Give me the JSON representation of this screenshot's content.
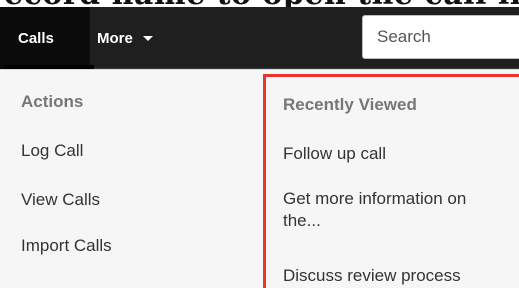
{
  "caption": {
    "partial_text": "ecord name to open the call in de"
  },
  "navbar": {
    "tabs": [
      {
        "label": "Calls",
        "active": true
      },
      {
        "label": "More",
        "has_caret": true
      }
    ],
    "search": {
      "placeholder": "Search"
    }
  },
  "dropdown": {
    "actions": {
      "header": "Actions",
      "items": [
        "Log Call",
        "View Calls",
        "Import Calls"
      ]
    },
    "recently_viewed": {
      "header": "Recently Viewed",
      "items": [
        "Follow up call",
        "Get more information on the...",
        "Discuss review process"
      ],
      "highlight_color": "#e8372a"
    }
  },
  "colors": {
    "navbar_bg": "#1f1f1f",
    "active_tab_bg": "#0b0b0b",
    "dropdown_bg": "#f6f6f6",
    "header_text": "#777777",
    "link_text": "#333333"
  },
  "icons": {
    "more_caret": "caret-down-icon"
  }
}
